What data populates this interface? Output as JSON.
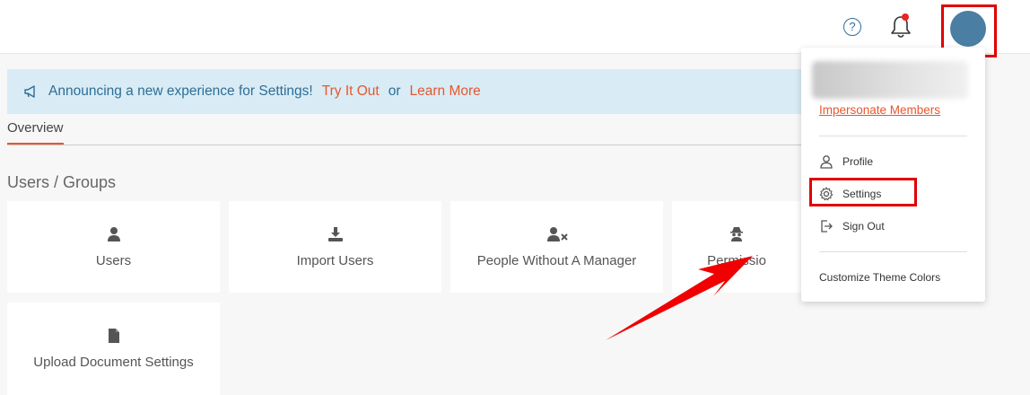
{
  "banner": {
    "text": "Announcing a new experience for Settings!",
    "try_link": "Try It Out",
    "or": "or",
    "learn_link": "Learn More"
  },
  "tabs": [
    {
      "label": "Overview",
      "active": true
    }
  ],
  "section": {
    "title": "Users / Groups"
  },
  "cards": [
    {
      "label": "Users",
      "icon": "user-icon"
    },
    {
      "label": "Import Users",
      "icon": "download-icon"
    },
    {
      "label": "People Without A Manager",
      "icon": "user-x-icon"
    },
    {
      "label": "Permissio",
      "icon": "spy-icon"
    },
    {
      "label": "Upload Document Settings",
      "icon": "file-icon"
    }
  ],
  "topbar": {
    "help_glyph": "?",
    "notification_dot": true
  },
  "dropdown": {
    "impersonate": "Impersonate Members",
    "items": [
      {
        "label": "Profile",
        "icon": "user-outline-icon"
      },
      {
        "label": "Settings",
        "icon": "gear-icon"
      },
      {
        "label": "Sign Out",
        "icon": "sign-out-icon"
      }
    ],
    "theme": "Customize Theme Colors"
  },
  "colors": {
    "accent": "#e8562e",
    "banner_bg": "#d9ecf5",
    "banner_text": "#2d6e96",
    "highlight": "#e00000",
    "avatar": "#4a7ea3"
  }
}
